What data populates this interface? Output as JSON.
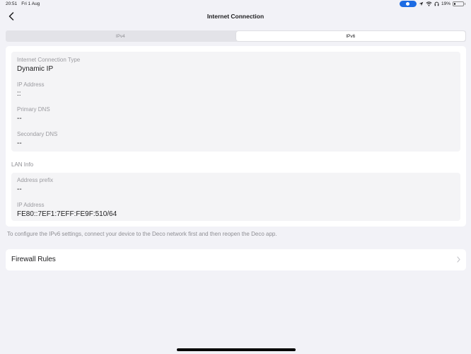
{
  "status_bar": {
    "time": "20:51",
    "date": "Fri 1 Aug",
    "battery": "19%",
    "battery_level": 0.19
  },
  "nav": {
    "title": "Internet Connection"
  },
  "tabs": [
    {
      "label": "IPv4",
      "active": false
    },
    {
      "label": "IPv6",
      "active": true
    }
  ],
  "connection": {
    "type_label": "Internet Connection Type",
    "type_value": "Dynamic IP",
    "ip_label": "IP Address",
    "ip_value": "::",
    "primary_dns_label": "Primary DNS",
    "primary_dns_value": "--",
    "secondary_dns_label": "Secondary DNS",
    "secondary_dns_value": "--"
  },
  "lan": {
    "group_label": "LAN Info",
    "prefix_label": "Address prefix",
    "prefix_value": "--",
    "ip_label": "IP Address",
    "ip_value": "FE80::7EF1:7EFF:FE9F:510/64"
  },
  "hint": "To configure the IPv6 settings, connect your device to the Deco network first and then reopen the Deco app.",
  "firewall": {
    "label": "Firewall Rules"
  },
  "colors": {
    "background": "#f2f2f7",
    "accent": "#1c6be3"
  }
}
